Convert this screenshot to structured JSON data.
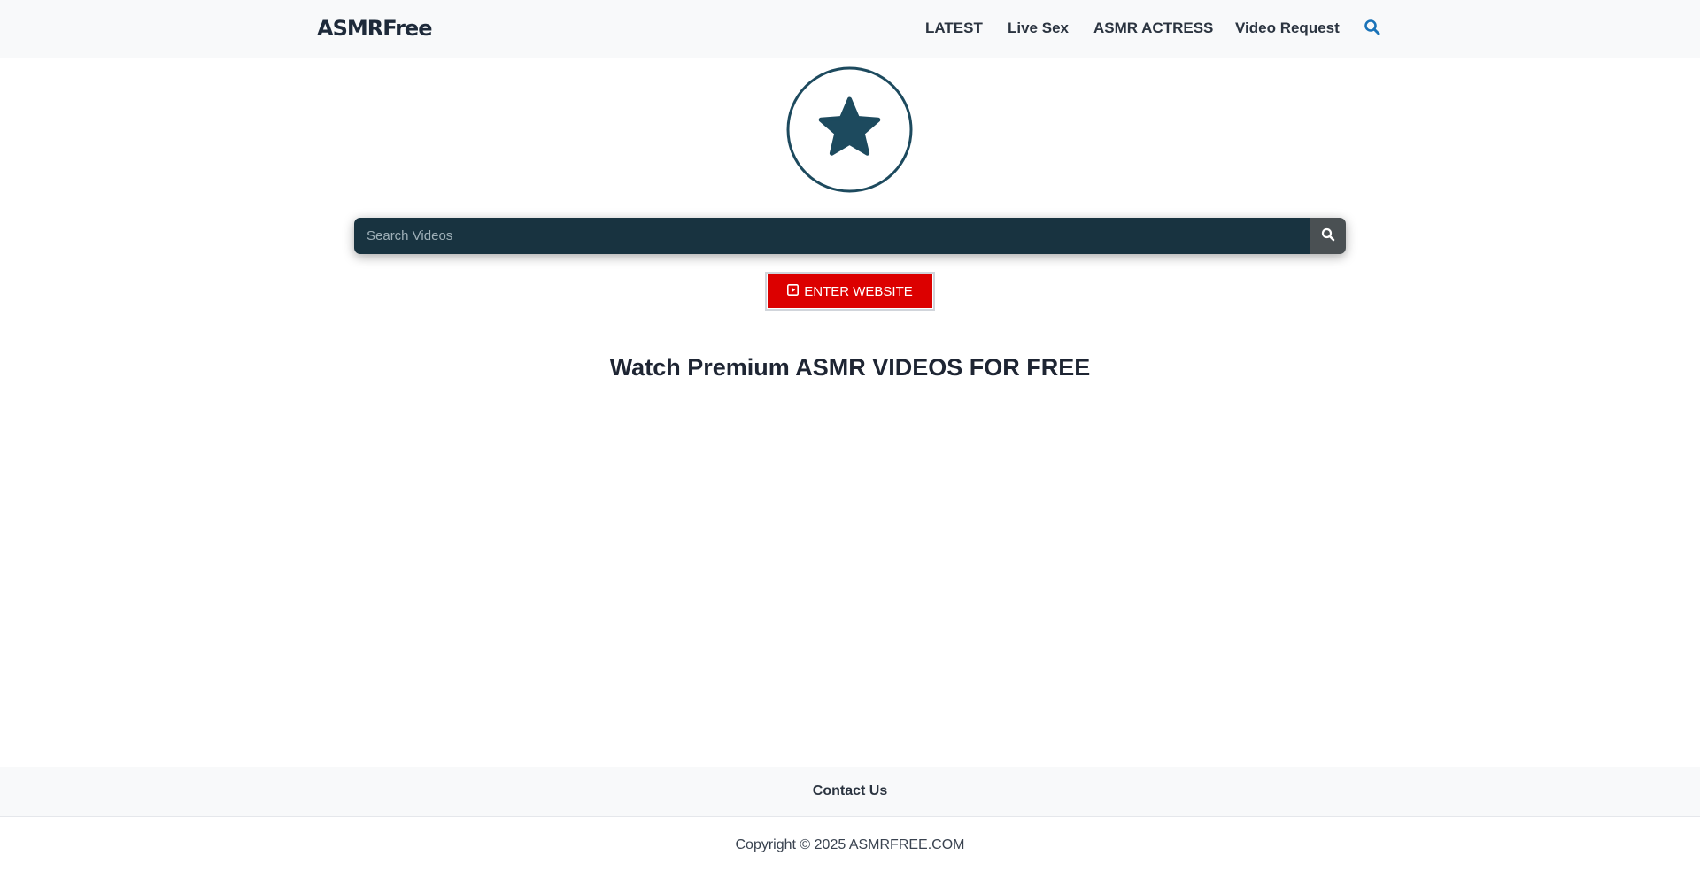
{
  "header": {
    "logo_text": "ASMRFree",
    "nav": [
      {
        "label": "LATEST"
      },
      {
        "label": "Live Sex"
      },
      {
        "label": "ASMR ACTRESS"
      },
      {
        "label": "Video Request"
      }
    ],
    "search_icon": "search-icon",
    "accent_color": "#1a73b8"
  },
  "hero": {
    "badge_icon": "star-icon",
    "badge_color": "#1d4a5e"
  },
  "search": {
    "placeholder": "Search Videos",
    "button_icon": "search-icon"
  },
  "enter_button": {
    "icon": "play-square-icon",
    "label": "ENTER WEBSITE",
    "color": "#dc0000"
  },
  "headline": "Watch Premium ASMR VIDEOS FOR FREE",
  "footer": {
    "contact_label": "Contact Us",
    "copyright": "Copyright © 2025 ASMRFREE.COM"
  }
}
